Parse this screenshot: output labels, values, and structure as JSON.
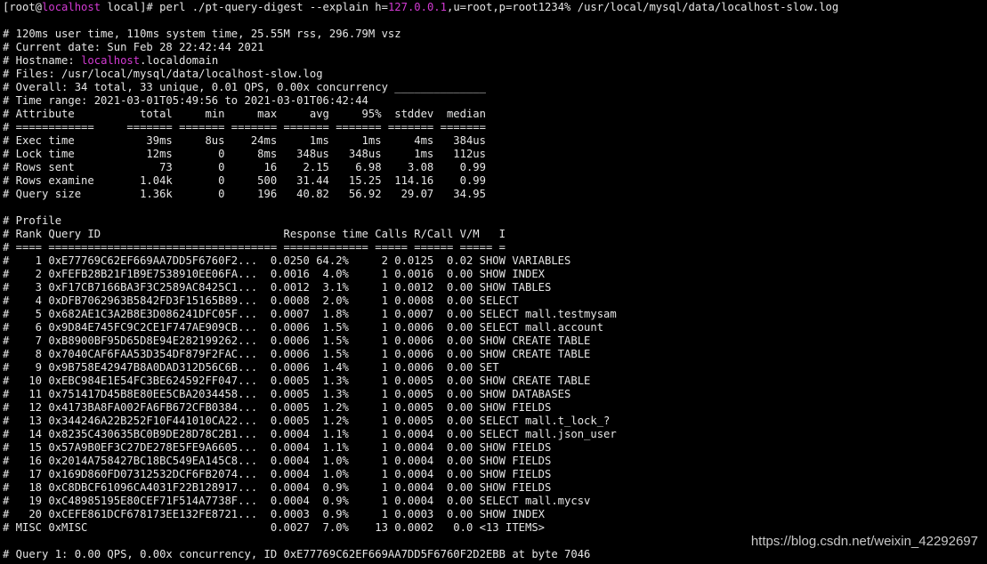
{
  "terminal": {
    "highlight_color": "#d33ad3",
    "text_color": "#e6e6e6",
    "background": "#000000",
    "lines": [
      {
        "segments": [
          {
            "t": "[root@"
          },
          {
            "t": "localhost",
            "hl": true
          },
          {
            "t": " local]# perl ./pt-query-digest --explain h="
          },
          {
            "t": "127.0.0.1",
            "hl": true
          },
          {
            "t": ",u=root,p=root1234% /usr/local/mysql/data/localhost-slow.log"
          }
        ]
      },
      {
        "segments": [
          {
            "t": ""
          }
        ]
      },
      {
        "segments": [
          {
            "t": "# 120ms user time, 110ms system time, 25.55M rss, 296.79M vsz"
          }
        ]
      },
      {
        "segments": [
          {
            "t": "# Current date: Sun Feb 28 22:42:44 2021"
          }
        ]
      },
      {
        "segments": [
          {
            "t": "# Hostname: "
          },
          {
            "t": "localhost",
            "hl": true
          },
          {
            "t": ".localdomain"
          }
        ]
      },
      {
        "segments": [
          {
            "t": "# Files: /usr/local/mysql/data/localhost-slow.log"
          }
        ]
      },
      {
        "segments": [
          {
            "t": "# Overall: 34 total, 33 unique, 0.01 QPS, 0.00x concurrency ______________"
          }
        ]
      },
      {
        "segments": [
          {
            "t": "# Time range: 2021-03-01T05:49:56 to 2021-03-01T06:42:44"
          }
        ]
      },
      {
        "segments": [
          {
            "t": "# Attribute          total     min     max     avg     95%  stddev  median"
          }
        ]
      },
      {
        "segments": [
          {
            "t": "# ============     ======= ======= ======= ======= ======= ======= ======="
          }
        ]
      },
      {
        "segments": [
          {
            "t": "# Exec time           39ms     8us    24ms     1ms     1ms     4ms   384us"
          }
        ]
      },
      {
        "segments": [
          {
            "t": "# Lock time           12ms       0     8ms   348us   348us     1ms   112us"
          }
        ]
      },
      {
        "segments": [
          {
            "t": "# Rows sent             73       0      16    2.15    6.98    3.08    0.99"
          }
        ]
      },
      {
        "segments": [
          {
            "t": "# Rows examine       1.04k       0     500   31.44   15.25  114.16    0.99"
          }
        ]
      },
      {
        "segments": [
          {
            "t": "# Query size         1.36k       0     196   40.82   56.92   29.07   34.95"
          }
        ]
      },
      {
        "segments": [
          {
            "t": ""
          }
        ]
      },
      {
        "segments": [
          {
            "t": "# Profile"
          }
        ]
      },
      {
        "segments": [
          {
            "t": "# Rank Query ID                            Response time Calls R/Call V/M   I"
          }
        ]
      },
      {
        "segments": [
          {
            "t": "# ==== =================================== ============= ===== ====== ===== ="
          }
        ]
      },
      {
        "segments": [
          {
            "t": "#    1 0xE77769C62EF669AA7DD5F6760F2...  0.0250 64.2%     2 0.0125  0.02 SHOW VARIABLES"
          }
        ]
      },
      {
        "segments": [
          {
            "t": "#    2 0xFEFB28B21F1B9E7538910EE06FA...  0.0016  4.0%     1 0.0016  0.00 SHOW INDEX"
          }
        ]
      },
      {
        "segments": [
          {
            "t": "#    3 0xF17CB7166BA3F3C2589AC8425C1...  0.0012  3.1%     1 0.0012  0.00 SHOW TABLES"
          }
        ]
      },
      {
        "segments": [
          {
            "t": "#    4 0xDFB7062963B5842FD3F15165B89...  0.0008  2.0%     1 0.0008  0.00 SELECT"
          }
        ]
      },
      {
        "segments": [
          {
            "t": "#    5 0x682AE1C3A2B8E3D086241DFC05F...  0.0007  1.8%     1 0.0007  0.00 SELECT mall.testmysam"
          }
        ]
      },
      {
        "segments": [
          {
            "t": "#    6 0x9D84E745FC9C2CE1F747AE909CB...  0.0006  1.5%     1 0.0006  0.00 SELECT mall.account"
          }
        ]
      },
      {
        "segments": [
          {
            "t": "#    7 0xB8900BF95D65D8E94E282199262...  0.0006  1.5%     1 0.0006  0.00 SHOW CREATE TABLE"
          }
        ]
      },
      {
        "segments": [
          {
            "t": "#    8 0x7040CAF6FAA53D354DF879F2FAC...  0.0006  1.5%     1 0.0006  0.00 SHOW CREATE TABLE"
          }
        ]
      },
      {
        "segments": [
          {
            "t": "#    9 0x9B758E42947B8A0DAD312D56C6B...  0.0006  1.4%     1 0.0006  0.00 SET"
          }
        ]
      },
      {
        "segments": [
          {
            "t": "#   10 0xEBC984E1E54FC3BE624592FF047...  0.0005  1.3%     1 0.0005  0.00 SHOW CREATE TABLE"
          }
        ]
      },
      {
        "segments": [
          {
            "t": "#   11 0x751417D45B8E80EE5CBA2034458...  0.0005  1.3%     1 0.0005  0.00 SHOW DATABASES"
          }
        ]
      },
      {
        "segments": [
          {
            "t": "#   12 0x4173BA8FA002FA6FB672CFB0384...  0.0005  1.2%     1 0.0005  0.00 SHOW FIELDS"
          }
        ]
      },
      {
        "segments": [
          {
            "t": "#   13 0x344246A22B252F10F441010CA22...  0.0005  1.2%     1 0.0005  0.00 SELECT mall.t_lock_?"
          }
        ]
      },
      {
        "segments": [
          {
            "t": "#   14 0x8235C430635BC0B9DE28D78C2B1...  0.0004  1.1%     1 0.0004  0.00 SELECT mall.json_user"
          }
        ]
      },
      {
        "segments": [
          {
            "t": "#   15 0x57A9B0EF3C27DE278E5FE9A6605...  0.0004  1.1%     1 0.0004  0.00 SHOW FIELDS"
          }
        ]
      },
      {
        "segments": [
          {
            "t": "#   16 0x2014A758427BC18BC549EA145C8...  0.0004  1.0%     1 0.0004  0.00 SHOW FIELDS"
          }
        ]
      },
      {
        "segments": [
          {
            "t": "#   17 0x169D860FD07312532DCF6FB2074...  0.0004  1.0%     1 0.0004  0.00 SHOW FIELDS"
          }
        ]
      },
      {
        "segments": [
          {
            "t": "#   18 0xC8DBCF61096CA4031F22B128917...  0.0004  0.9%     1 0.0004  0.00 SHOW FIELDS"
          }
        ]
      },
      {
        "segments": [
          {
            "t": "#   19 0xC48985195E80CEF71F514A7738F...  0.0004  0.9%     1 0.0004  0.00 SELECT mall.mycsv"
          }
        ]
      },
      {
        "segments": [
          {
            "t": "#   20 0xCEFE861DCF678173EE132FE8721...  0.0003  0.9%     1 0.0003  0.00 SHOW INDEX"
          }
        ]
      },
      {
        "segments": [
          {
            "t": "# MISC 0xMISC                            0.0027  7.0%    13 0.0002   0.0 <13 ITEMS>"
          }
        ]
      },
      {
        "segments": [
          {
            "t": ""
          }
        ]
      },
      {
        "segments": [
          {
            "t": "# Query 1: 0.00 QPS, 0.00x concurrency, ID 0xE77769C62EF669AA7DD5F6760F2D2EBB at byte 7046"
          }
        ]
      }
    ]
  },
  "watermark": {
    "text": "https://blog.csdn.net/weixin_42292697"
  }
}
